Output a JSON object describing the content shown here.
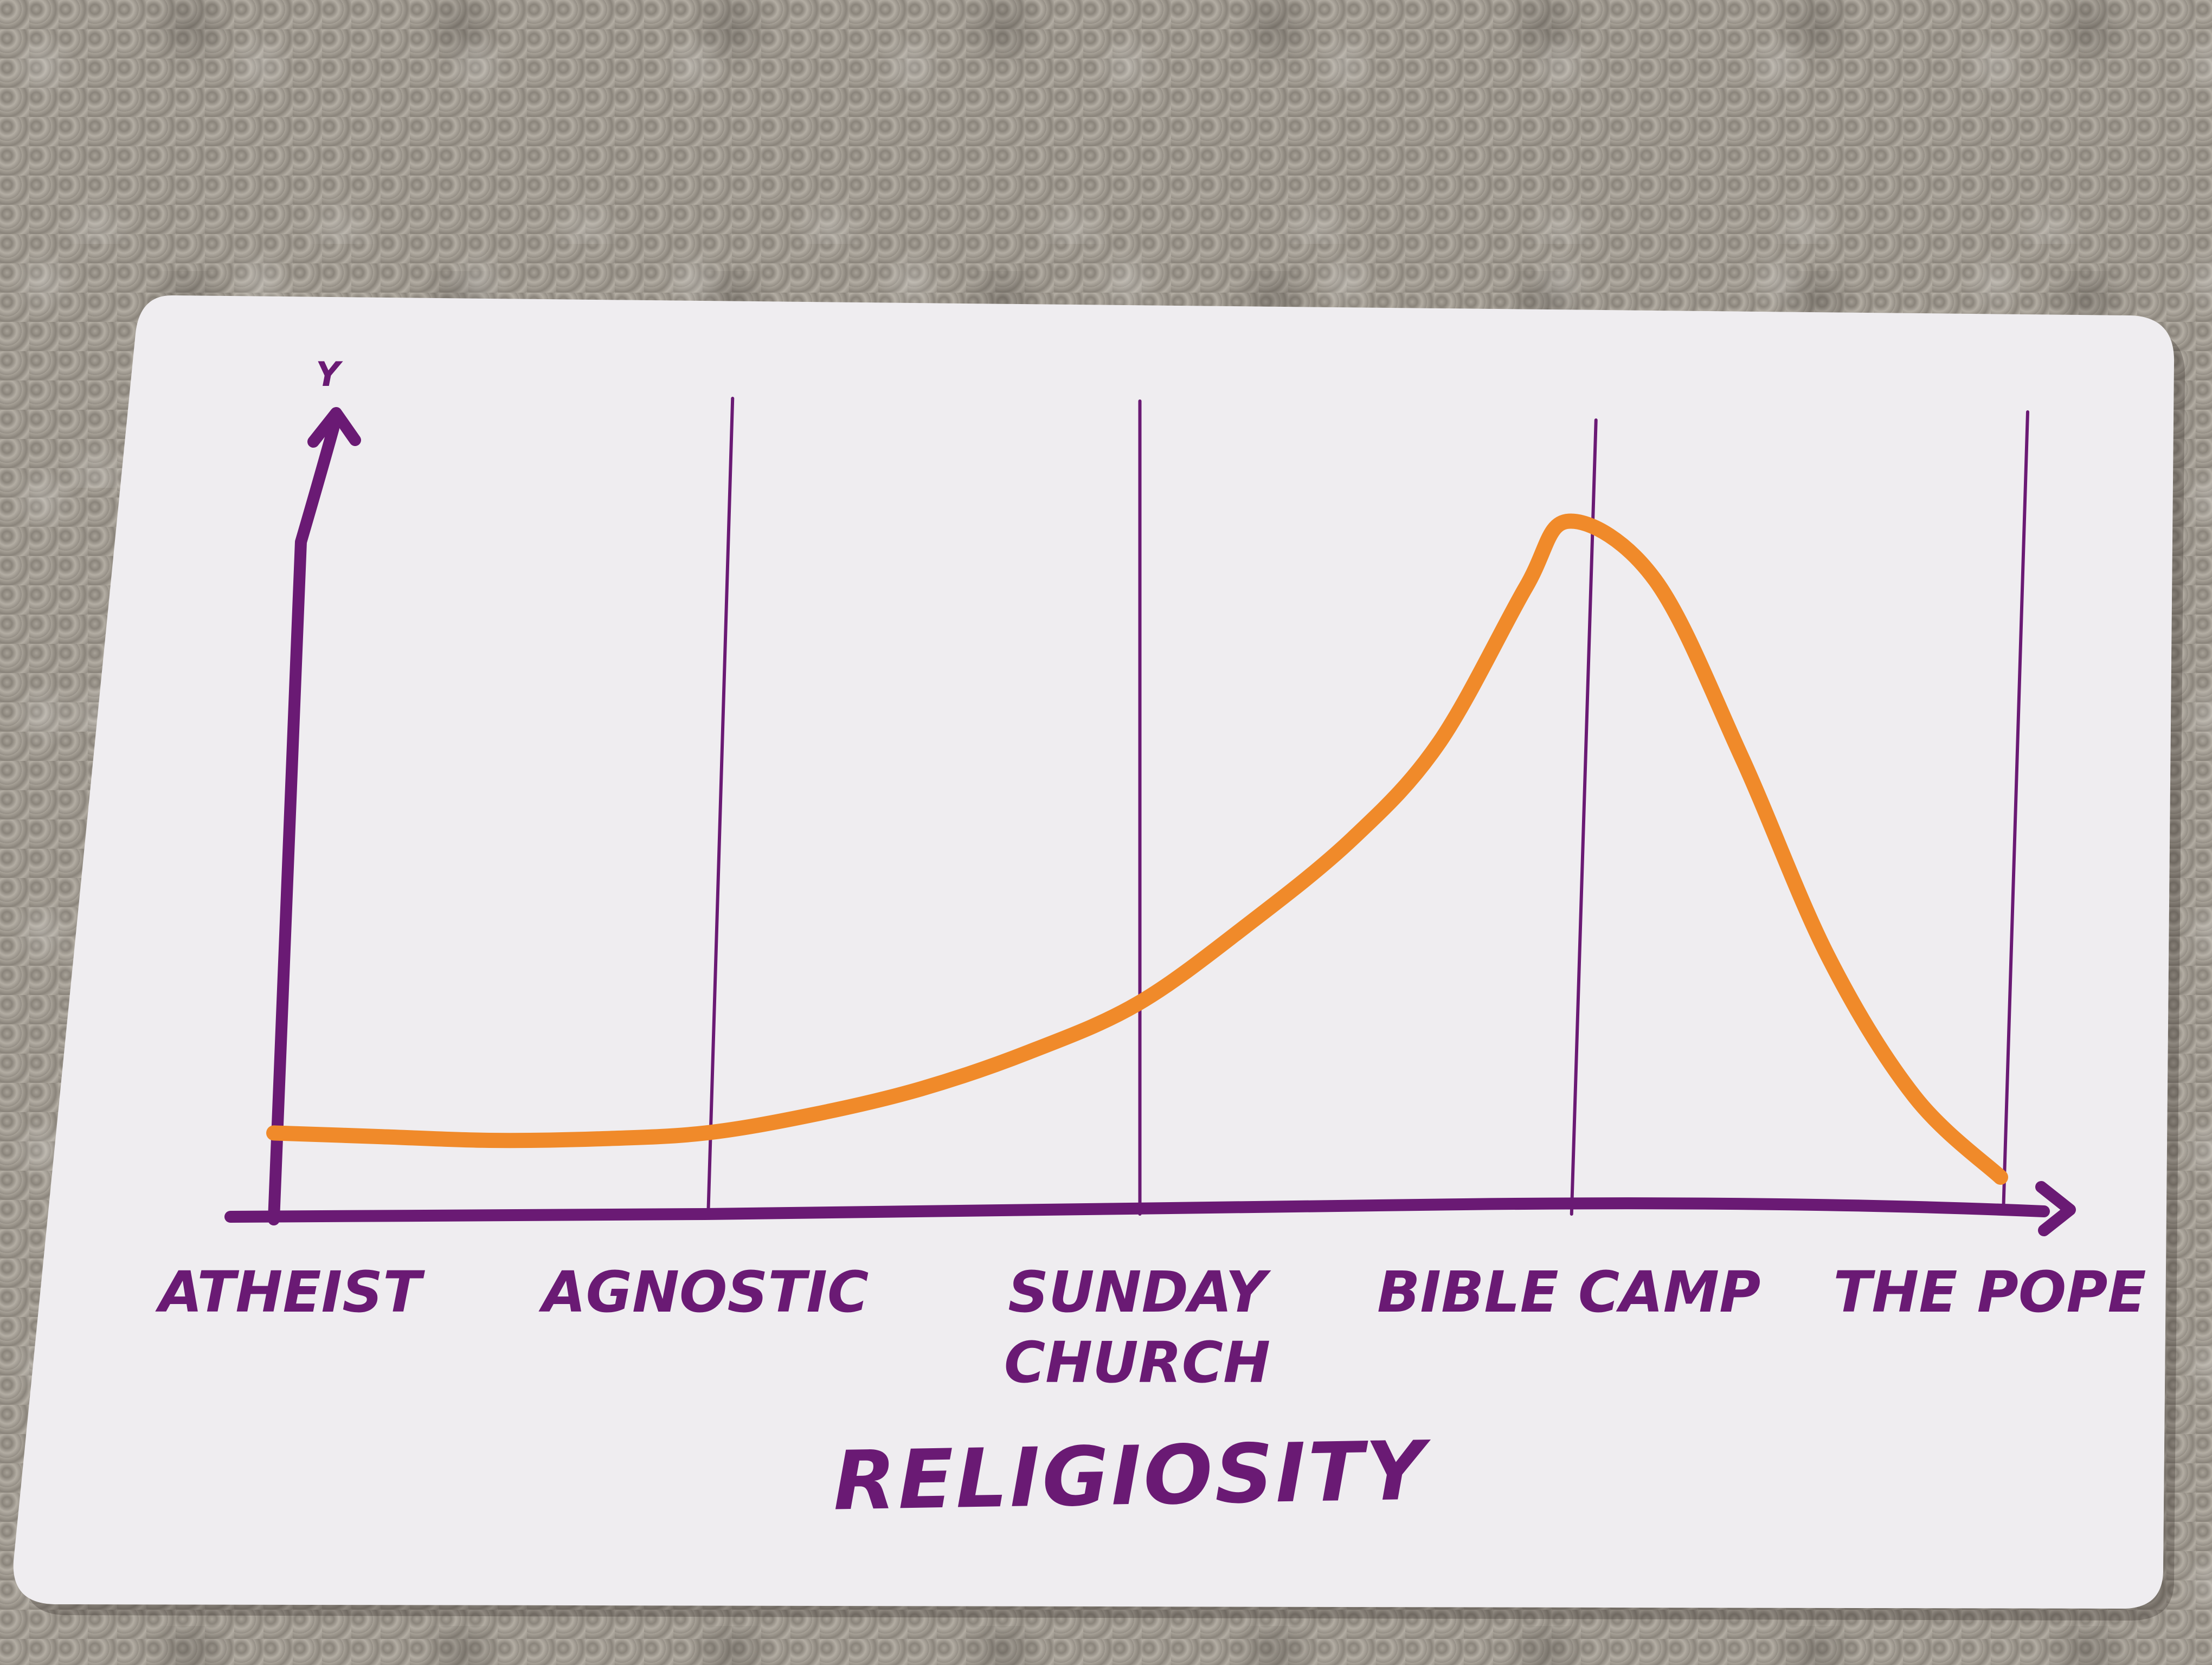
{
  "colors": {
    "axis": "#6a1a74",
    "curve": "#f08a2a",
    "card": "#efedf0",
    "background": "#9b958c"
  },
  "chart_data": {
    "type": "line",
    "xlabel": "RELIGIOSITY",
    "ylabel": "Y",
    "categories": [
      "ATHEIST",
      "AGNOSTIC",
      "SUNDAY CHURCH",
      "BIBLE CAMP",
      "THE POPE"
    ],
    "tick_labels": [
      [
        "ATHEIST"
      ],
      [
        "AGNOSTIC"
      ],
      [
        "SUNDAY",
        "CHURCH"
      ],
      [
        "BIBLE CAMP"
      ],
      [
        "THE POPE"
      ]
    ],
    "xlim": [
      0,
      4
    ],
    "ylim": [
      0,
      10
    ],
    "grid": "vertical lines at each category",
    "legend": "none",
    "series": [
      {
        "x": [
          0,
          0.25,
          0.5,
          0.75,
          1.0,
          1.25,
          1.5,
          1.75,
          2.0,
          2.25,
          2.5,
          2.7,
          2.9,
          3.0,
          3.2,
          3.4,
          3.6,
          3.8,
          4.0
        ],
        "y": [
          1.1,
          1.05,
          1.0,
          1.02,
          1.1,
          1.35,
          1.7,
          2.2,
          2.85,
          3.9,
          5.1,
          6.4,
          8.5,
          9.4,
          8.6,
          6.2,
          3.5,
          1.6,
          0.5
        ]
      }
    ]
  }
}
